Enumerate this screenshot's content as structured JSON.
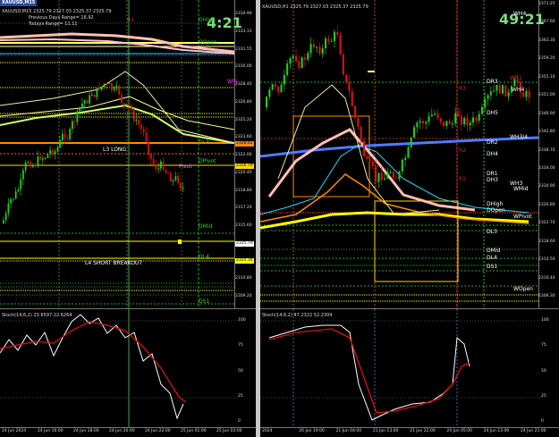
{
  "left": {
    "title": "XAUUSD,M15",
    "info_line": "XAUUSD,M15 2325.79 2327.03 2325.37 2325.79",
    "previous_days_range": "Previous Days Range= 16.92",
    "todays_range": "Todays Range= 11.11",
    "countdown": "4:21",
    "osc_label": "Stoch(14,6,2) 23.6597 22.6264",
    "labels": {
      "dhigh": "DHigh",
      "dopen": "DOpen",
      "wpivot": "WPi",
      "dl3": "DL3",
      "dpivot": "DPivot",
      "pivot": "Pivot",
      "dmid": "DMid",
      "dl4": "DL4",
      "ds1": "DS1",
      "l3long": "L3 LONG",
      "l4short": "L4 SHORT BREAKOUT",
      "r1": "R1"
    },
    "price_axis": [
      "2334.90",
      "2333.15",
      "2331.55",
      "2330.00",
      "2328.40",
      "2326.80",
      "2325.20",
      "2323.60",
      "2322.00",
      "2320.40",
      "2318.80",
      "2317.20",
      "2315.60",
      "2314.00",
      "2312.40",
      "2310.80",
      "2309.20"
    ],
    "price_tags": [
      {
        "text": "2328.02",
        "color": "#ff8c00"
      },
      {
        "text": "2326.79",
        "color": "#ffd700"
      },
      {
        "text": "2325.79",
        "color": "#ffffff"
      },
      {
        "text": "2325.16",
        "color": "#ffff00"
      }
    ],
    "osc_axis": [
      "100",
      "75",
      "50",
      "25",
      "0"
    ],
    "time_axis": [
      "24 Jun 2024",
      "24 Jun 16:00",
      "24 Jun 18:00",
      "24 Jun 20:00",
      "24 Jun 22:00",
      "25 Jun 01:00",
      "25 Jun 03:00"
    ]
  },
  "right": {
    "title": "XAUUSD,H1",
    "info_line": "XAUUSD,H1 2325.79 2327.03 2325.37 2325.79",
    "countdown": "49:21",
    "osc_label": "Stoch(14,6,2) 47.2322 52.2304",
    "labels": {
      "wh4": "WH4",
      "wr1": "WR1",
      "wh3": "WH3",
      "dr3": "DR3",
      "dh5": "DH5",
      "wh3_4": "WH3/4",
      "dr2": "DR2",
      "dh4": "DH4",
      "dr1": "DR1",
      "dh3": "DH3",
      "wmid": "WMid",
      "dhigh": "DHigh",
      "dopen": "DOpen",
      "wpivot": "WPivot",
      "dl3": "DL3",
      "dmid": "DMid",
      "dl4": "DL4",
      "ds1": "DS1",
      "wopen": "WOpen",
      "r3": "R3",
      "r2": "R2",
      "r1": "R1"
    },
    "price_axis": [
      "2371.25",
      "2367.60",
      "2363.30",
      "2359.20",
      "2355.10",
      "2351.00",
      "2346.90",
      "2342.80",
      "2338.70",
      "2334.00",
      "2330.90",
      "2326.80",
      "2322.70",
      "2318.60",
      "2314.50",
      "2310.40",
      "2306.30"
    ],
    "osc_axis": [
      "100",
      "75",
      "50",
      "25",
      "0"
    ],
    "time_axis": [
      "2024",
      "20 Jun 19:00",
      "21 Jun 04:00",
      "21 Jun 13:00",
      "21 Jun 22:00",
      "24 Jun 05:00",
      "24 Jun 13:00",
      "24 Jun 21:00"
    ]
  },
  "colors": {
    "bull": "#22cc22",
    "bear": "#dd1111",
    "pivot_green": "#22aa22",
    "yellow": "#ffff00",
    "blue": "#4d7cff",
    "cyan": "#22ddff",
    "orange": "#ff8c00",
    "pink": "#ffc0b0",
    "stoch_main": "#ffffff",
    "stoch_signal": "#dd1111",
    "tab_blue": "#2a4a9a"
  }
}
